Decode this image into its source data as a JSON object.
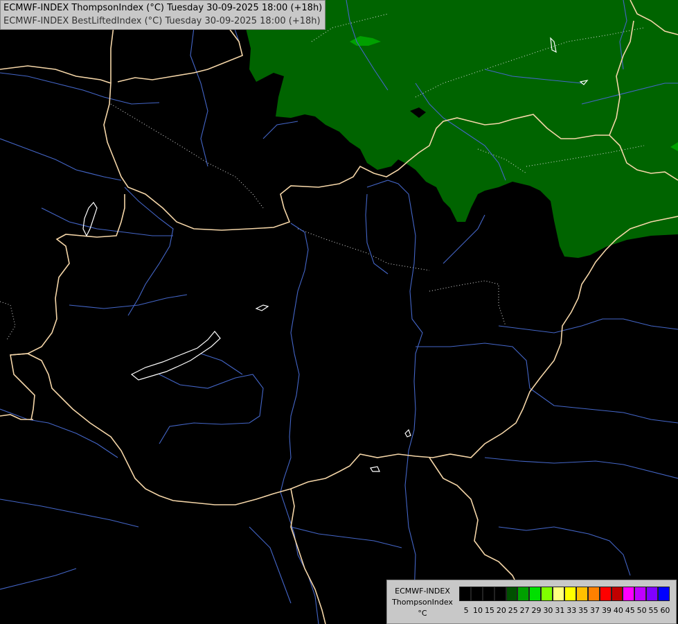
{
  "header": {
    "line1": "ECMWF-INDEX ThompsonIndex (°C) Tuesday 30-09-2025 18:00 (+18h)",
    "line2": "ECMWF-INDEX BestLiftedIndex (°C) Tuesday 30-09-2025 18:00 (+18h)"
  },
  "legend": {
    "line1": "ECMWF-INDEX",
    "line2": "ThompsonIndex",
    "unit": "°C",
    "colors": [
      "#000000",
      "#000000",
      "#000000",
      "#000000",
      "#005000",
      "#00a000",
      "#00e000",
      "#80ff00",
      "#ffff80",
      "#ffff00",
      "#ffc000",
      "#ff8000",
      "#ff0000",
      "#c00000",
      "#ff00ff",
      "#c000ff",
      "#8000ff",
      "#0000ff"
    ],
    "ticks": [
      "5",
      "10",
      "15",
      "20",
      "25",
      "27",
      "29",
      "30",
      "31",
      "33",
      "35",
      "37",
      "39",
      "40",
      "45",
      "50",
      "55",
      "60"
    ]
  },
  "map": {
    "colors": {
      "background": "#000000",
      "field": "#006400",
      "field_patch": "#00a000",
      "border": "#f5d6a8",
      "river": "#4466c8",
      "lake": "#ffffff"
    }
  }
}
